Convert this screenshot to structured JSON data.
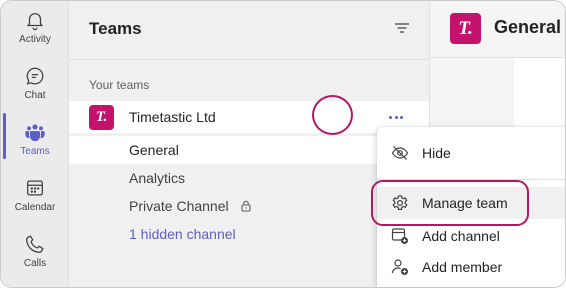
{
  "rail": {
    "items": [
      {
        "label": "Activity",
        "icon": "bell-icon"
      },
      {
        "label": "Chat",
        "icon": "chat-icon"
      },
      {
        "label": "Teams",
        "icon": "teams-icon"
      },
      {
        "label": "Calendar",
        "icon": "calendar-icon"
      },
      {
        "label": "Calls",
        "icon": "phone-icon"
      }
    ],
    "active": "Teams"
  },
  "panel": {
    "title": "Teams",
    "section_label": "Your teams",
    "team": {
      "avatar": "T.",
      "name": "Timetastic Ltd"
    },
    "channels": {
      "general": "General",
      "analytics": "Analytics",
      "private": "Private Channel",
      "hidden": "1 hidden channel"
    }
  },
  "main": {
    "avatar": "T.",
    "title": "General"
  },
  "menu": {
    "hide": "Hide",
    "manage_team": "Manage team",
    "add_channel": "Add channel",
    "add_member": "Add member"
  },
  "colors": {
    "accent": "#5b5fc7",
    "brand": "#c4136c",
    "highlight_ring": "#b01a64"
  }
}
